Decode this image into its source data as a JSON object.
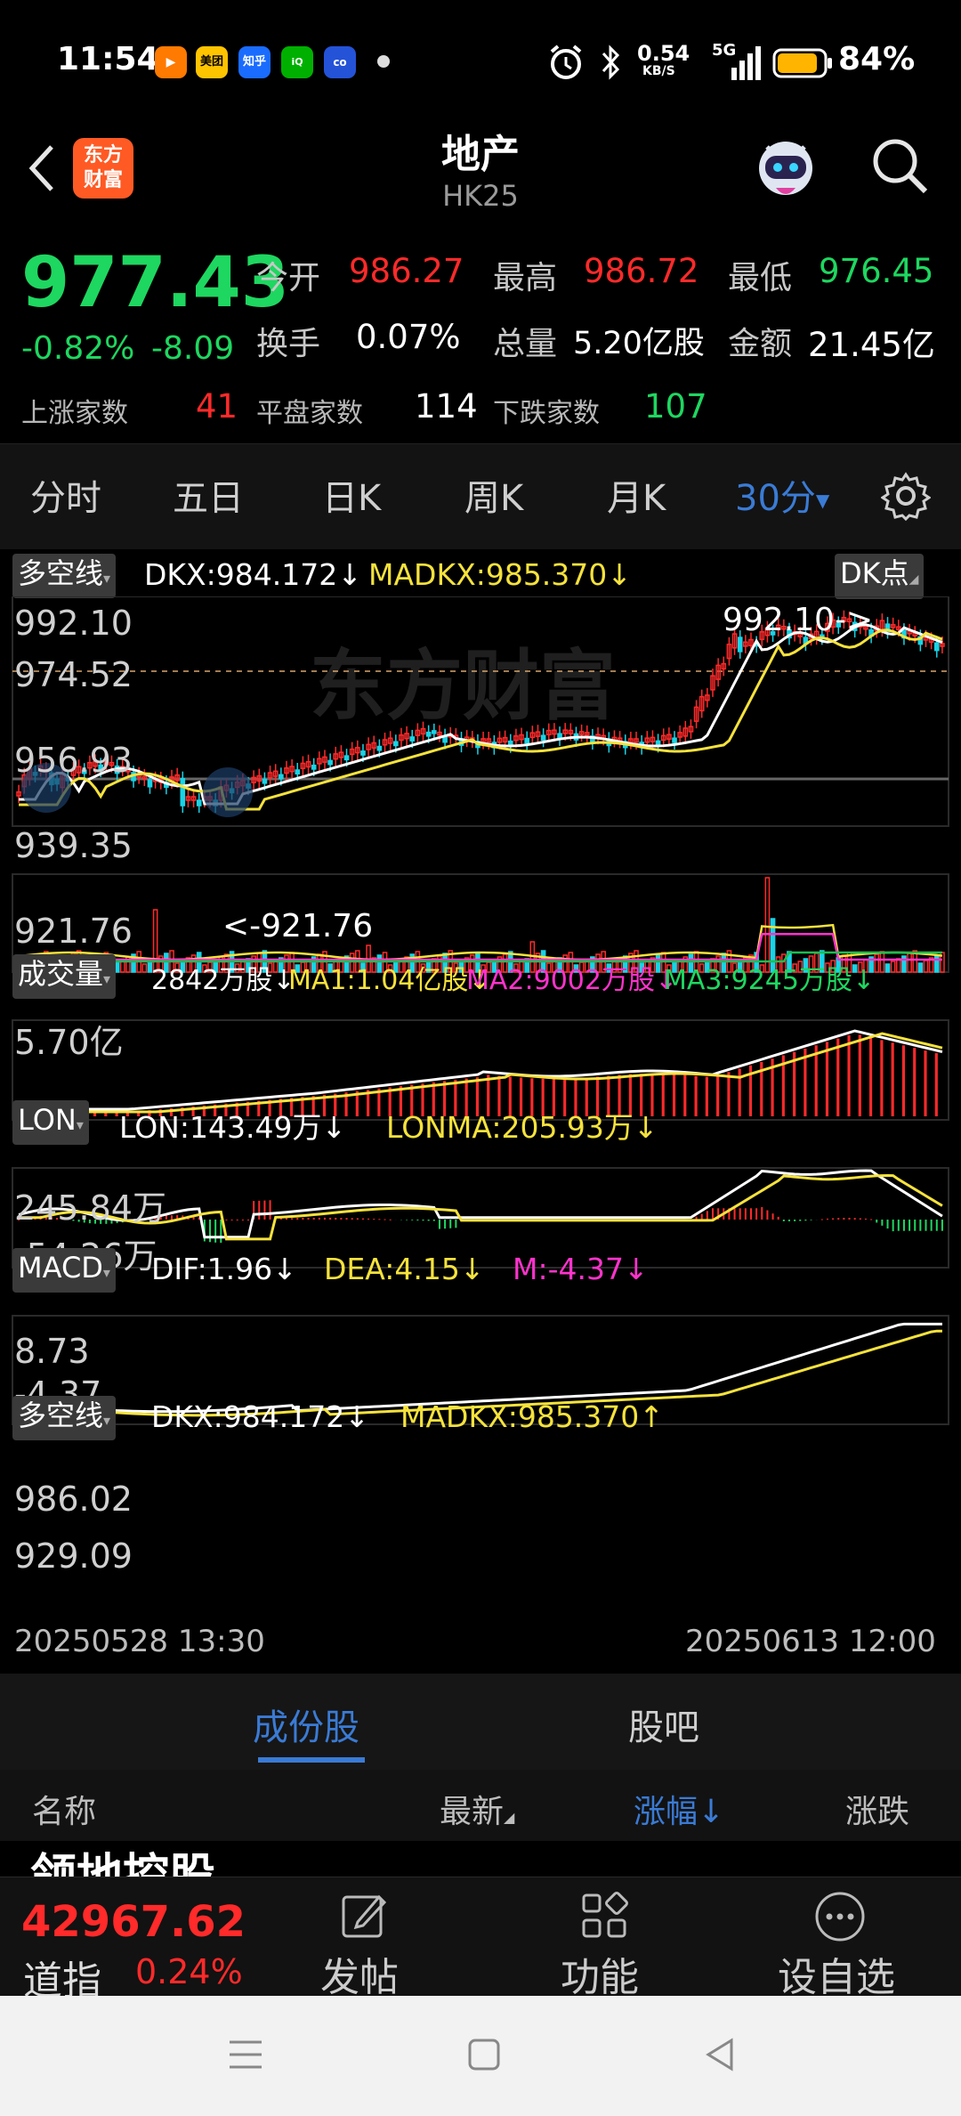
{
  "status_bar": {
    "time": "11:54",
    "apps": [
      "美团",
      "知乎"
    ],
    "speed_top": "0.54",
    "speed_unit": "KB/S",
    "network": "5G",
    "battery": "84%"
  },
  "header": {
    "title": "地产",
    "code": "HK25",
    "logo_line1": "东方",
    "logo_line2": "财富"
  },
  "quote": {
    "price": "977.43",
    "change_pct": "-0.82%",
    "change": "-8.09",
    "open_label": "今开",
    "open": "986.27",
    "high_label": "最高",
    "high": "986.72",
    "low_label": "最低",
    "low": "976.45",
    "turnover_label": "换手",
    "turnover": "0.07%",
    "volume_label": "总量",
    "volume": "5.20亿股",
    "amount_label": "金额",
    "amount": "21.45亿",
    "up_label": "上涨家数",
    "up": "41",
    "flat_label": "平盘家数",
    "flat": "114",
    "down_label": "下跌家数",
    "down": "107"
  },
  "period_tabs": [
    "分时",
    "五日",
    "日K",
    "周K",
    "月K",
    "30分"
  ],
  "active_period": "30分",
  "kline": {
    "selector": "多空线",
    "dkx": "DKX:984.172",
    "madkx": "MADKX:985.370",
    "dk_button": "DK点",
    "y_labels": [
      "992.10",
      "974.52",
      "956.93",
      "939.35",
      "921.76"
    ],
    "high_marker": "992.10->",
    "low_marker": "<-921.76",
    "watermark": "东方财富"
  },
  "volume": {
    "selector": "成交量",
    "vol": "2842万股",
    "ma1": "MA1:1.04亿股",
    "ma2": "MA2:9002万股",
    "ma3": "MA3:9245万股",
    "y_label": "5.70亿"
  },
  "lon": {
    "selector": "LON",
    "lon": "LON:143.49万",
    "lonma": "LONMA:205.93万",
    "y_top": "245.84万",
    "y_bottom": "-54.26万"
  },
  "macd": {
    "selector": "MACD",
    "dif": "DIF:1.96",
    "dea": "DEA:4.15",
    "m": "M:-4.37",
    "y_top": "8.73",
    "y_bottom": "-4.37"
  },
  "dkx2": {
    "selector": "多空线",
    "dkx": "DKX:984.172",
    "madkx": "MADKX:985.370",
    "y_top": "986.02",
    "y_bottom": "929.09"
  },
  "time_axis": {
    "start": "20250528 13:30",
    "end": "20250613 12:00"
  },
  "sub_tabs": [
    "成份股",
    "股吧"
  ],
  "list_header": {
    "name": "名称",
    "latest": "最新",
    "change_pct": "涨幅",
    "change": "涨跌"
  },
  "first_row_partial": "领地控股",
  "bottom_bar": {
    "index_value": "42967.62",
    "index_name": "道指",
    "index_pct": "0.24%",
    "post": "发帖",
    "func": "功能",
    "watch": "设自选"
  },
  "colors": {
    "up": "#ff2a2a",
    "down": "#1ed760",
    "accent": "#3a7bd5",
    "yellow": "#f5e23c",
    "magenta": "#ff33cc",
    "cyan": "#19d3e6"
  }
}
